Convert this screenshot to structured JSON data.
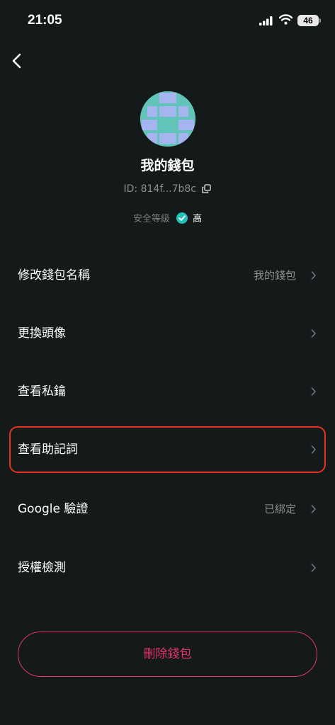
{
  "status_bar": {
    "time": "21:05",
    "battery": "46"
  },
  "profile": {
    "wallet_name": "我的錢包",
    "id_text": "ID: 814f...7b8c",
    "security_label": "安全等級",
    "security_level": "高",
    "colors": {
      "avatar_bg": "#62c4b8",
      "avatar_blocks": "#a6b4f0",
      "check": "#20c2b8"
    }
  },
  "menu": [
    {
      "label": "修改錢包名稱",
      "value": "我的錢包"
    },
    {
      "label": "更換頭像",
      "value": ""
    },
    {
      "label": "查看私鑰",
      "value": ""
    },
    {
      "label": "查看助記詞",
      "value": ""
    },
    {
      "label": "Google 驗證",
      "value": "已綁定"
    },
    {
      "label": "授權檢測",
      "value": ""
    }
  ],
  "delete_button": {
    "label": "刪除錢包",
    "color": "#e2316f"
  },
  "highlight_color": "#e8321f"
}
